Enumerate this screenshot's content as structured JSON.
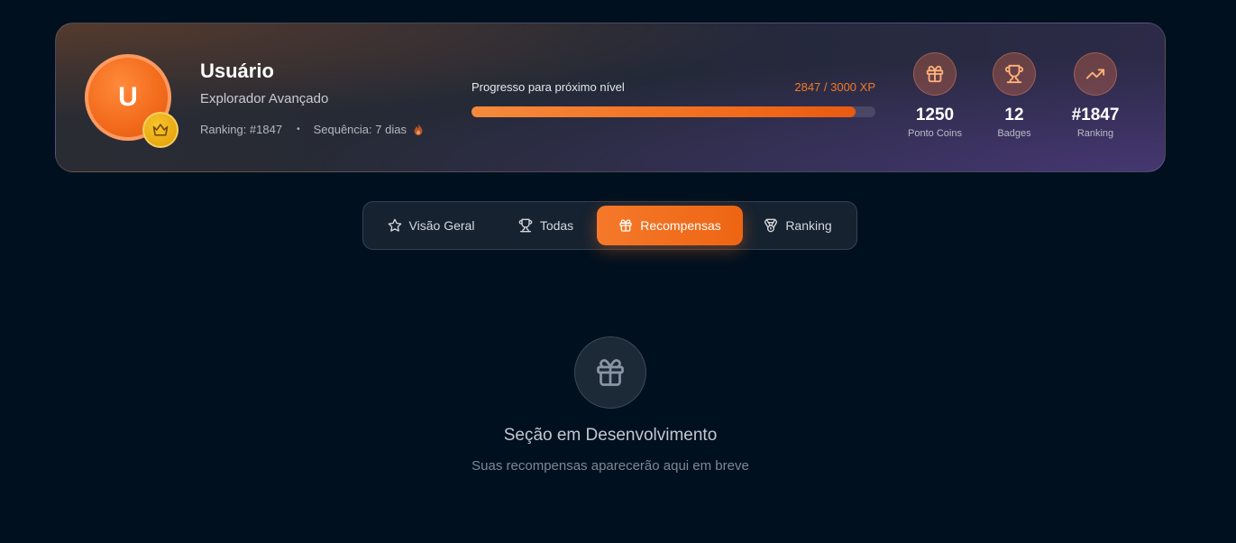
{
  "user": {
    "avatar_initial": "U",
    "name": "Usuário",
    "title": "Explorador Avançado",
    "ranking_text": "Ranking: #1847",
    "separator": "•",
    "streak_text": "Sequência: 7 dias"
  },
  "progress": {
    "label": "Progresso para próximo nível",
    "xp_text": "2847 / 3000 XP",
    "current": 2847,
    "max": 3000,
    "fill_percent": 95
  },
  "stats": [
    {
      "icon": "gift-icon",
      "value": "1250",
      "label": "Ponto Coins"
    },
    {
      "icon": "trophy-icon",
      "value": "12",
      "label": "Badges"
    },
    {
      "icon": "trending-up-icon",
      "value": "#1847",
      "label": "Ranking"
    }
  ],
  "tabs": [
    {
      "label": "Visão Geral",
      "icon": "star-icon",
      "active": false
    },
    {
      "label": "Todas",
      "icon": "trophy-icon",
      "active": false
    },
    {
      "label": "Recompensas",
      "icon": "gift-icon",
      "active": true
    },
    {
      "label": "Ranking",
      "icon": "medal-icon",
      "active": false
    }
  ],
  "empty_state": {
    "icon": "gift-icon",
    "title": "Seção em Desenvolvimento",
    "subtitle": "Suas recompensas aparecerão aqui em breve"
  },
  "colors": {
    "background": "#00101f",
    "accent": "#f26a1b",
    "xp_text": "#f27a26",
    "crown_badge": "#f0b41a"
  }
}
